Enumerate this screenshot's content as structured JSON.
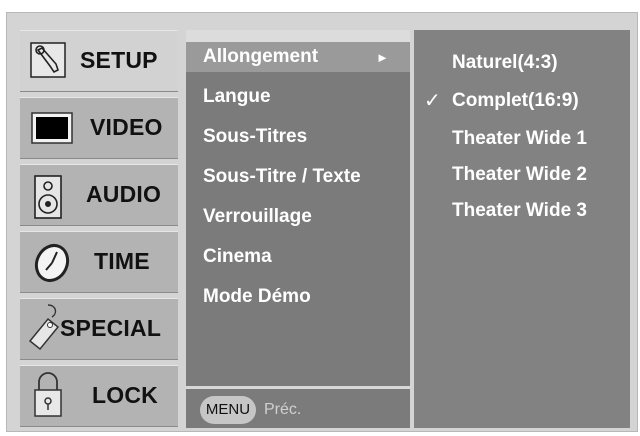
{
  "categories": [
    {
      "label": "SETUP",
      "icon": "wrench-icon"
    },
    {
      "label": "VIDEO",
      "icon": "screen-icon"
    },
    {
      "label": "AUDIO",
      "icon": "speaker-icon"
    },
    {
      "label": "TIME",
      "icon": "clock-icon"
    },
    {
      "label": "SPECIAL",
      "icon": "tag-icon"
    },
    {
      "label": "LOCK",
      "icon": "padlock-icon"
    }
  ],
  "submenu": {
    "items": [
      "Allongement",
      "Langue",
      "Sous-Titres",
      "Sous-Titre / Texte",
      "Verrouillage",
      "Cinema",
      "Mode Démo"
    ],
    "selected_arrow": "►",
    "footer": {
      "menu_button": "MENU",
      "back_label": "Préc."
    }
  },
  "options": {
    "items": [
      "Naturel(4:3)",
      "Complet(16:9)",
      "Theater Wide 1",
      "Theater Wide 2",
      "Theater Wide 3"
    ],
    "check_mark": "✓"
  }
}
